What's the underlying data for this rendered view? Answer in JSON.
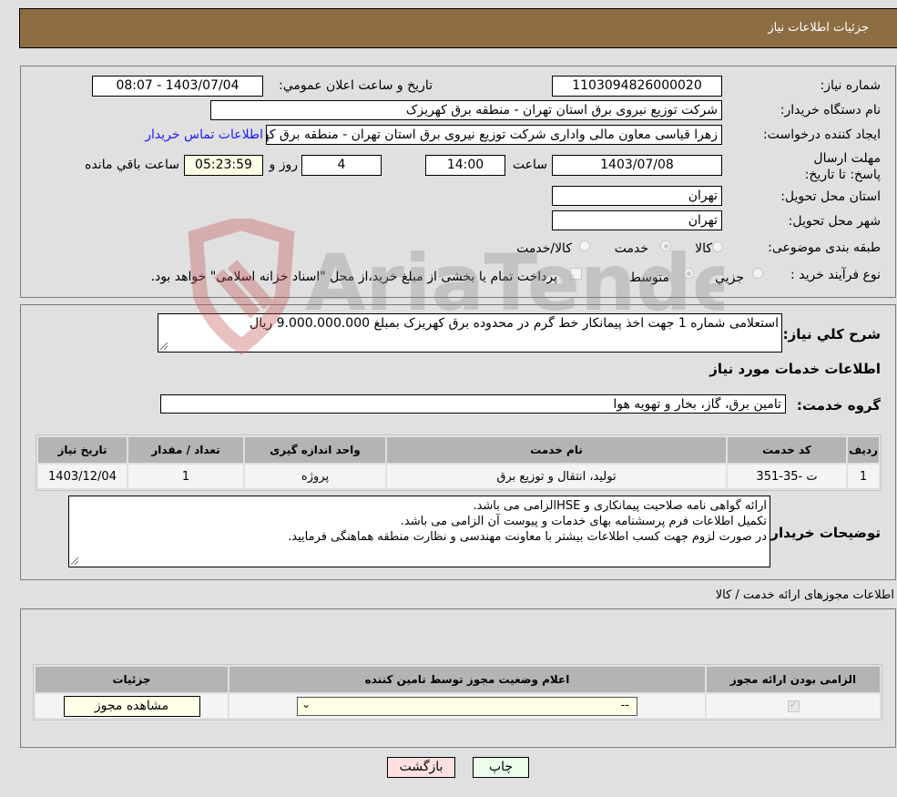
{
  "header": {
    "title": "جزئیات اطلاعات نیاز"
  },
  "info": {
    "need_number_label": "شماره نیاز:",
    "need_number": "1103094826000020",
    "announce_label": "تاریخ و ساعت اعلان عمومي:",
    "announce_value": "1403/07/04 - 08:07",
    "buyer_org_label": "نام دستگاه خریدار:",
    "buyer_org": "شرکت توزیع نیروی برق استان تهران  - منطقه برق کهریزک",
    "requester_label": "ایجاد کننده درخواست:",
    "requester": "زهرا قیاسی معاون مالی واداری شرکت توزیع نیروی برق استان تهران  - منطقه برق کهریزک",
    "buyer_contact_link": "اطلاعات تماس خریدار",
    "deadline_label": "مهلت ارسال پاسخ: تا تاریخ:",
    "deadline_date": "1403/07/08",
    "time_label": "ساعت",
    "deadline_time": "14:00",
    "days_value": "4",
    "days_label": "روز و",
    "remaining_time": "05:23:59",
    "remaining_label": "ساعت باقي مانده",
    "province_label": "استان محل تحویل:",
    "province": "تهران",
    "city_label": "شهر محل تحویل:",
    "city": "تهران",
    "category_label": "طبقه بندی موضوعی:",
    "category_options": [
      {
        "label": "کالا",
        "checked": false
      },
      {
        "label": "خدمت",
        "checked": true
      },
      {
        "label": "کالا/خدمت",
        "checked": false
      }
    ],
    "process_label": "نوع فرآیند خرید :",
    "process_options": [
      {
        "label": "جزيي",
        "checked": false
      },
      {
        "label": "متوسط",
        "checked": true
      }
    ],
    "treasury_checkbox_label": "پرداخت تمام یا بخشی از مبلغ خرید،از محل \"اسناد خزانه اسلامی\" خواهد بود.",
    "treasury_checked": false
  },
  "details": {
    "summary_label": "شرح کلي نیاز:",
    "summary": "استعلامی شماره 1 جهت اخذ پیمانکار خط گرم در محدوده برق کهریزک بمبلغ 9.000.000.000 ریال",
    "services_heading": "اطلاعات خدمات مورد نیاز",
    "service_group_label": "گروه خدمت:",
    "service_group": "تامین برق، گاز، بخار و تهویه هوا",
    "table": {
      "headers": [
        "ردیف",
        "کد خدمت",
        "نام خدمت",
        "واحد اندازه گیری",
        "تعداد / مقدار",
        "تاریخ نیاز"
      ],
      "rows": [
        [
          "1",
          "ت -35-351",
          "تولید، انتقال و توزیع برق",
          "پروژه",
          "1",
          "1403/12/04"
        ]
      ]
    },
    "buyer_notes_label": "توضیحات خریدار:",
    "buyer_notes": [
      "ارائه گواهی نامه صلاحیت پیمانکاری و HSEالزامی می باشد.",
      "تکمیل اطلاعات فرم پرسشنامه بهای خدمات و پیوست آن الزامی می باشد.",
      "در صورت لزوم جهت کسب اطلاعات بیشتر با معاونت مهندسی و نظارت منطقه هماهنگی فرمایید."
    ]
  },
  "licenses": {
    "heading": "اطلاعات مجوزهای ارائه خدمت / کالا",
    "headers": [
      "الزامی بودن ارائه مجوز",
      "اعلام وضعیت مجوز توسط تامین کننده",
      "جزئیات"
    ],
    "row": {
      "required_checked": true,
      "status_select": "--",
      "view_button": "مشاهده مجوز"
    }
  },
  "footer": {
    "print_button": "چاپ",
    "back_button": "بازگشت"
  },
  "watermark": {
    "text": "AriaTender.neT"
  }
}
